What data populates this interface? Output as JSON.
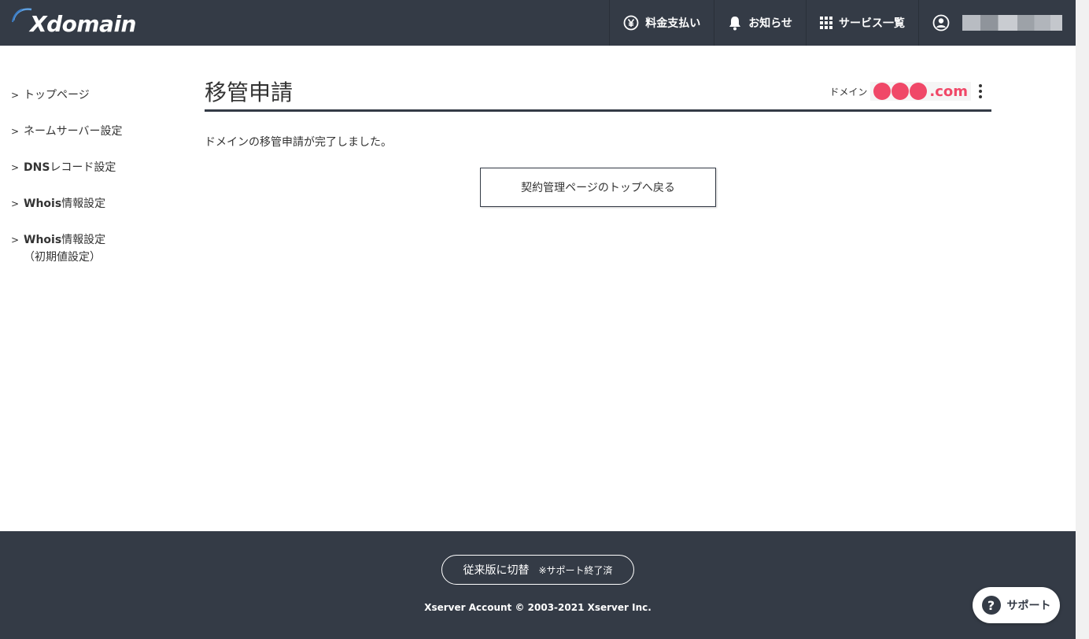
{
  "header": {
    "logo_text": "Xdomain",
    "nav": [
      {
        "label": "料金支払い",
        "icon": "yen-icon"
      },
      {
        "label": "お知らせ",
        "icon": "bell-icon"
      },
      {
        "label": "サービス一覧",
        "icon": "grid-icon"
      }
    ],
    "user_icon": "user-icon"
  },
  "sidebar": {
    "items": [
      {
        "label": "トップページ"
      },
      {
        "label": "ネームサーバー設定"
      },
      {
        "label_bold": "DNS",
        "label": "レコード設定"
      },
      {
        "label_bold": "Whois",
        "label": "情報設定"
      },
      {
        "label_bold": "Whois",
        "label": "情報設定",
        "sub": "（初期値設定）"
      }
    ]
  },
  "main": {
    "title": "移管申請",
    "domain_label": "ドメイン",
    "domain_suffix": ".com",
    "message": "ドメインの移管申請が完了しました。",
    "back_button": "契約管理ページのトップへ戻る"
  },
  "footer": {
    "legacy_button": "従来版に切替",
    "legacy_note": "※サポート終了済",
    "copyright": "Xserver Account © 2003-2021 Xserver Inc."
  },
  "support_button": "サポート",
  "colors": {
    "header_bg": "#343b46",
    "accent_pink": "#f04868"
  }
}
